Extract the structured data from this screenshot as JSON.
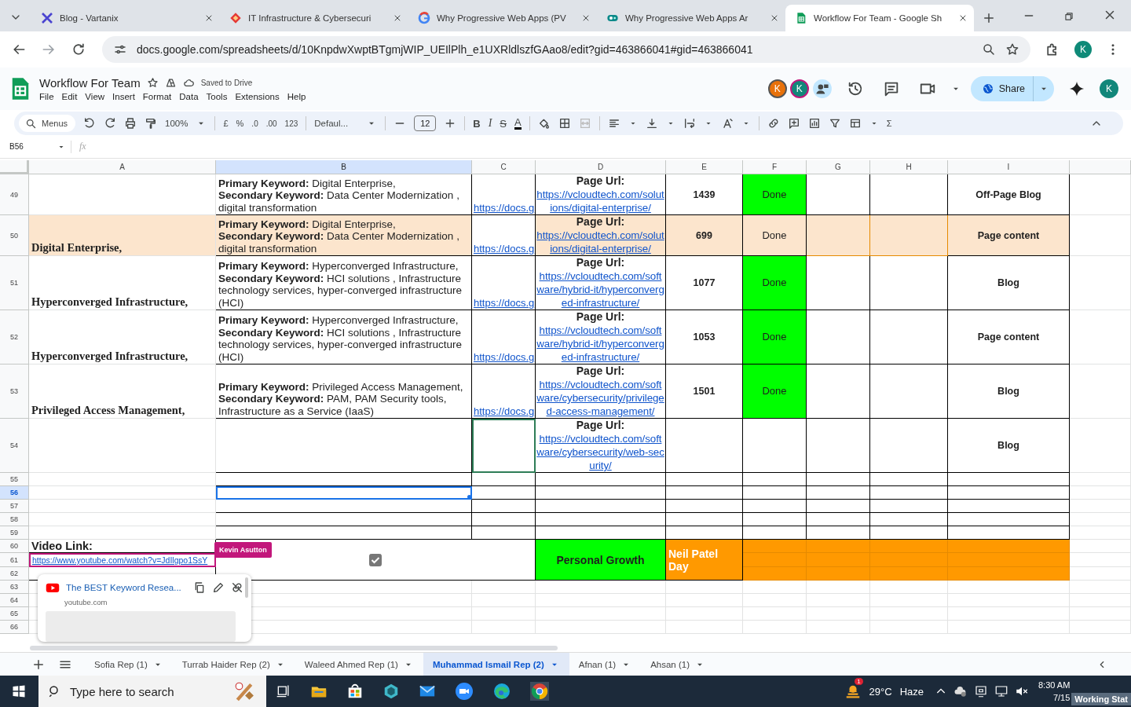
{
  "browser": {
    "tabs": [
      {
        "title": "Blog - Vartanix",
        "selected": false
      },
      {
        "title": "IT Infrastructure & Cybersecuri",
        "selected": false
      },
      {
        "title": "Why Progressive Web Apps (PV",
        "selected": false
      },
      {
        "title": "Why Progressive Web Apps Ar",
        "selected": false
      },
      {
        "title": "Workflow For Team - Google Sh",
        "selected": true
      }
    ],
    "url": "docs.google.com/spreadsheets/d/10KnpdwXwptBTgmjWIP_UEIlPlh_e1UXRldlszfGAao8/edit?gid=463866041#gid=463866041",
    "profile": "K"
  },
  "doc": {
    "title": "Workflow For Team",
    "save_status": "Saved to Drive",
    "menus": [
      "File",
      "Edit",
      "View",
      "Insert",
      "Format",
      "Data",
      "Tools",
      "Extensions",
      "Help"
    ],
    "collaborator_avatars": [
      {
        "letter": "K",
        "color": "#e8710a"
      },
      {
        "letter": "K",
        "color": "#12877a"
      }
    ],
    "share": "Share",
    "account": "K"
  },
  "toolbar": {
    "search": "Menus",
    "zoom": "100%",
    "currency": "£",
    "percent": "%",
    "decrease_decimals": ".0",
    "increase_decimals": ".00",
    "number_format": "123",
    "font": "Defaul...",
    "font_size": "12",
    "bold": "B",
    "italic": "I",
    "strike": "S",
    "text_color": "A",
    "functions": "Σ"
  },
  "formula_bar": {
    "cell": "B56",
    "fx": "fx"
  },
  "grid": {
    "columns": [
      {
        "label": "A",
        "selected": false
      },
      {
        "label": "B",
        "selected": true
      },
      {
        "label": "C",
        "selected": false
      },
      {
        "label": "D",
        "selected": false
      },
      {
        "label": "E",
        "selected": false
      },
      {
        "label": "F",
        "selected": false
      },
      {
        "label": "G",
        "selected": false
      },
      {
        "label": "H",
        "selected": false
      },
      {
        "label": "I",
        "selected": false
      }
    ],
    "rows": [
      {
        "num": "49",
        "selected": false,
        "cells": [
          "",
          {
            "kind": "keywords",
            "text": "**Primary Keyword:** Digital Enterprise,\n**Secondary Keyword:** Data Center Modernization , digital transformation"
          },
          {
            "kind": "link",
            "text": "https://docs.g"
          },
          {
            "kind": "page-url",
            "label": "Page Url:",
            "url": "https://vcloudtech.com/solutions/digital-enterprise/"
          },
          {
            "kind": "number",
            "text": "1439"
          },
          {
            "kind": "status",
            "text": "Done",
            "color": "#00ff00"
          },
          "",
          "",
          {
            "kind": "type",
            "text": "Off-Page Blog"
          }
        ]
      },
      {
        "num": "50",
        "selected": false,
        "cells": [
          {
            "kind": "label",
            "text": "Digital Enterprise,",
            "color": "#fce5cd"
          },
          {
            "kind": "keywords",
            "text": "**Primary Keyword:** Digital Enterprise,\n**Secondary Keyword:** Data Center Modernization , digital transformation",
            "color": "#fce5cd"
          },
          {
            "kind": "link",
            "text": "https://docs.g"
          },
          {
            "kind": "page-url",
            "label": "Page Url:",
            "url": "https://vcloudtech.com/solutions/digital-enterprise/",
            "color": "#fce5cd"
          },
          {
            "kind": "number",
            "text": "699",
            "color": "#fce5cd"
          },
          {
            "kind": "status",
            "text": "Done",
            "color": "#fce5cd"
          },
          {
            "kind": "fill",
            "color": "#fce5cd"
          },
          {
            "kind": "fill",
            "color": "#fce5cd"
          },
          {
            "kind": "type",
            "text": "Page content",
            "color": "#fce5cd"
          }
        ]
      },
      {
        "num": "51",
        "selected": false,
        "cells": [
          {
            "kind": "label",
            "text": "Hyperconverged Infrastructure,"
          },
          {
            "kind": "keywords",
            "text": "**Primary Keyword:** Hyperconverged Infrastructure,\n**Secondary Keyword:** HCI solutions , Infrastructure technology services, hyper-converged infrastructure (HCI)"
          },
          {
            "kind": "link",
            "text": "https://docs.g"
          },
          {
            "kind": "page-url",
            "label": "Page Url:",
            "url": "https://vcloudtech.com/software/hybrid-it/hyperconverged-infrastructure/"
          },
          {
            "kind": "number",
            "text": "1077"
          },
          {
            "kind": "status",
            "text": "Done",
            "color": "#00ff00"
          },
          "",
          "",
          {
            "kind": "type",
            "text": "Blog"
          }
        ]
      },
      {
        "num": "52",
        "selected": false,
        "cells": [
          {
            "kind": "label",
            "text": "Hyperconverged Infrastructure,"
          },
          {
            "kind": "keywords",
            "text": "**Primary Keyword:** Hyperconverged Infrastructure,\n**Secondary Keyword:** HCI solutions , Infrastructure technology services, hyper-converged infrastructure (HCI)"
          },
          {
            "kind": "link",
            "text": "https://docs.g"
          },
          {
            "kind": "page-url",
            "label": "Page Url:",
            "url": "https://vcloudtech.com/software/hybrid-it/hyperconverged-infrastructure/"
          },
          {
            "kind": "number",
            "text": "1053"
          },
          {
            "kind": "status",
            "text": "Done",
            "color": "#00ff00"
          },
          "",
          "",
          {
            "kind": "type",
            "text": "Page content"
          }
        ]
      },
      {
        "num": "53",
        "selected": false,
        "cells": [
          {
            "kind": "label",
            "text": "Privileged Access Management,"
          },
          {
            "kind": "keywords",
            "text": "**Primary Keyword:** Privileged Access Management,\n**Secondary Keyword:** PAM, PAM Security tools, Infrastructure as a Service (IaaS)"
          },
          {
            "kind": "link",
            "text": "https://docs.g"
          },
          {
            "kind": "page-url",
            "label": "Page Url:",
            "url": "https://vcloudtech.com/software/cybersecurity/privileged-access-management/"
          },
          {
            "kind": "number",
            "text": "1501"
          },
          {
            "kind": "status",
            "text": "Done",
            "color": "#00ff00"
          },
          "",
          "",
          {
            "kind": "type",
            "text": "Blog"
          }
        ]
      },
      {
        "num": "54",
        "selected": false,
        "cells": [
          "",
          "",
          {
            "kind": "empty",
            "collaborator": {
              "color": "#2e7d57"
            }
          },
          {
            "kind": "page-url",
            "label": "Page Url:",
            "url": "https://vcloudtech.com/software/cybersecurity/web-security/"
          },
          "",
          "",
          "",
          "",
          {
            "kind": "type",
            "text": "Blog"
          }
        ]
      },
      {
        "num": "55",
        "selected": false,
        "cells": []
      },
      {
        "num": "56",
        "selected": true,
        "cells": []
      },
      {
        "num": "57",
        "selected": false,
        "cells": []
      },
      {
        "num": "58",
        "selected": false,
        "cells": []
      },
      {
        "num": "59",
        "selected": false,
        "cells": []
      },
      {
        "num": "60",
        "selected": false,
        "cells": [
          {
            "kind": "heading",
            "text": "Video Link:"
          },
          {
            "kind": "checkbox",
            "checked": true,
            "colspan": 2,
            "rowspan": 3
          },
          {
            "kind": "banner",
            "text": "Personal Growth",
            "color": "#00ff00",
            "rowspan": 3
          },
          {
            "kind": "callout",
            "text": "Neil Patel Day",
            "color": "#ff9900",
            "rowspan": 3
          },
          {
            "kind": "fill",
            "color": "#ff9900"
          },
          {
            "kind": "fill",
            "color": "#ff9900"
          },
          {
            "kind": "fill",
            "color": "#ff9900"
          },
          {
            "kind": "fill",
            "color": "#ff9900"
          }
        ]
      },
      {
        "num": "61",
        "selected": false,
        "cells": [
          {
            "kind": "video-link",
            "text": "https://www.youtube.com/watch?v=JdIlgpo1SsY",
            "collaborator": {
              "name": "Kevin Asutton",
              "color": "#c2177b"
            }
          },
          {
            "kind": "fill",
            "color": "#ff9900"
          },
          {
            "kind": "fill",
            "color": "#ff9900"
          },
          {
            "kind": "fill",
            "color": "#ff9900"
          },
          {
            "kind": "fill",
            "color": "#ff9900"
          }
        ]
      },
      {
        "num": "62",
        "selected": false,
        "cells": [
          "",
          {
            "kind": "fill",
            "color": "#ff9900"
          },
          {
            "kind": "fill",
            "color": "#ff9900"
          },
          {
            "kind": "fill",
            "color": "#ff9900"
          },
          {
            "kind": "fill",
            "color": "#ff9900"
          }
        ]
      },
      {
        "num": "63",
        "selected": false,
        "cells": []
      },
      {
        "num": "64",
        "selected": false,
        "cells": []
      },
      {
        "num": "65",
        "selected": false,
        "cells": []
      },
      {
        "num": "66",
        "selected": false,
        "cells": []
      }
    ]
  },
  "link_preview": {
    "title": "The BEST Keyword Resea...",
    "domain": "youtube.com"
  },
  "sheet_tabs": [
    {
      "name": "Sofia Rep (1)",
      "selected": false
    },
    {
      "name": "Turrab Haider Rep (2)",
      "selected": false
    },
    {
      "name": "Waleed Ahmed Rep (1)",
      "selected": false
    },
    {
      "name": "Muhammad Ismail Rep (2)",
      "selected": true
    },
    {
      "name": "Afnan (1)",
      "selected": false
    },
    {
      "name": "Ahsan (1)",
      "selected": false
    }
  ],
  "taskbar": {
    "search_placeholder": "Type here to search",
    "weather_badge": "1",
    "temperature": "29°C",
    "weather": "Haze",
    "time": "8:30 AM",
    "date": "7/15",
    "overlay": "Working Stat"
  }
}
